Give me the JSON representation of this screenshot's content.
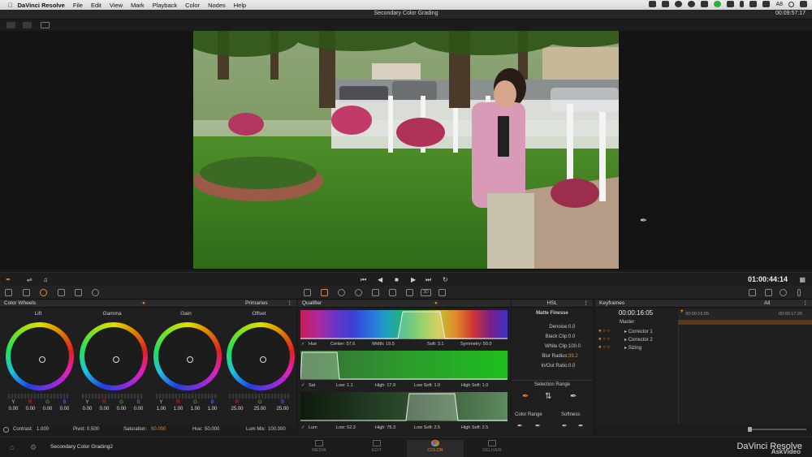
{
  "menubar": {
    "app_name": "DaVinci Resolve",
    "items": [
      "File",
      "Edit",
      "View",
      "Mark",
      "Playback",
      "Color",
      "Nodes",
      "Help"
    ],
    "status_text": "A8"
  },
  "project": {
    "title": "Secondary Color Grading",
    "timecode": "00:09:57:17"
  },
  "transport": {
    "timecode": "01:00:44:14"
  },
  "color_wheels": {
    "header": "Color Wheels",
    "mode": "Primaries",
    "wheels": [
      {
        "name": "Lift",
        "labels": [
          "Y",
          "R",
          "G",
          "B"
        ],
        "values": [
          "0.00",
          "0.00",
          "0.00",
          "0.00"
        ]
      },
      {
        "name": "Gamma",
        "labels": [
          "Y",
          "R",
          "G",
          "B"
        ],
        "values": [
          "0.00",
          "0.00",
          "0.00",
          "0.00"
        ]
      },
      {
        "name": "Gain",
        "labels": [
          "Y",
          "R",
          "G",
          "B"
        ],
        "values": [
          "1.00",
          "1.00",
          "1.00",
          "1.00"
        ]
      },
      {
        "name": "Offset",
        "labels": [
          "R",
          "G",
          "B"
        ],
        "values": [
          "25.00",
          "25.00",
          "25.00"
        ]
      }
    ],
    "footer": {
      "contrast_label": "Contrast:",
      "contrast": "1.000",
      "pivot_label": "Pivot:",
      "pivot": "0.500",
      "saturation_label": "Saturation:",
      "saturation": "50.000",
      "hue_label": "Hue:",
      "hue": "50.000",
      "lummix_label": "Lum Mix:",
      "lummix": "100.000"
    }
  },
  "qualifier": {
    "header": "Qualifier",
    "hue": {
      "label": "Hue",
      "center": "Center: 57.6",
      "width": "Width: 19.5",
      "soft": "Soft: 3.1",
      "symmetry": "Symmetry: 50.0"
    },
    "sat": {
      "label": "Sat",
      "low": "Low: 1.1",
      "high": "High: 17.9",
      "lowsoft": "Low Soft: 1.0",
      "highsoft": "High Soft: 1.0"
    },
    "lum": {
      "label": "Lum",
      "low": "Low: 52.3",
      "high": "High: 75.3",
      "lowsoft": "Low Soft: 2.5",
      "highsoft": "High Soft: 2.5"
    }
  },
  "hsl": {
    "header": "HSL",
    "matte_title": "Matte Finesse",
    "rows": [
      {
        "label": "Denoise:",
        "value": "0.0"
      },
      {
        "label": "Black Clip:",
        "value": "0.0"
      },
      {
        "label": "White Clip:",
        "value": "100.0"
      },
      {
        "label": "Blur Radius:",
        "value": "39.2"
      },
      {
        "label": "In/Out Ratio:",
        "value": "0.0"
      }
    ],
    "selection_title": "Selection Range",
    "color_range": "Color Range",
    "softness": "Softness"
  },
  "keyframes": {
    "header": "Keyframes",
    "filter": "All",
    "current": "00:00:16:05",
    "ruler_start": "00:00:16:05",
    "ruler_end": "00:00:17:20",
    "tracks": [
      "Master",
      "Corrector 1",
      "Corrector 2",
      "Sizing"
    ]
  },
  "pagebar": {
    "project_name": "Secondary Color Grading2",
    "tabs": [
      "MEDIA",
      "EDIT",
      "COLOR",
      "DELIVER"
    ],
    "brand": "DaVinci Resolve",
    "watermark": "AskVideo"
  },
  "colors": {
    "accent": "#e8862a"
  }
}
